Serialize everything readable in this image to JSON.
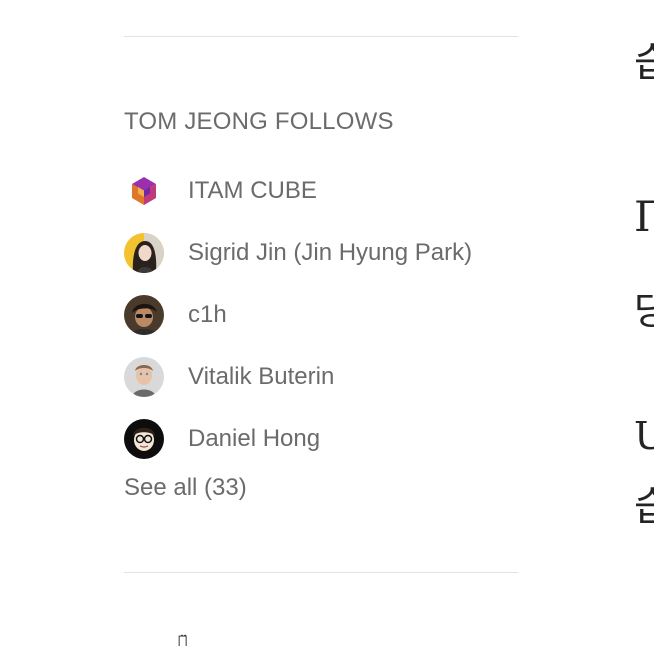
{
  "follows": {
    "title": "TOM JEONG FOLLOWS",
    "items": [
      {
        "name": "ITAM CUBE",
        "avatar_icon": "itam-cube-logo-icon"
      },
      {
        "name": "Sigrid Jin (Jin Hyung Park)",
        "avatar_icon": "person-avatar-icon"
      },
      {
        "name": "c1h",
        "avatar_icon": "person-avatar-icon"
      },
      {
        "name": "Vitalik Buterin",
        "avatar_icon": "person-avatar-icon"
      },
      {
        "name": "Daniel Hong",
        "avatar_icon": "person-avatar-icon"
      }
    ],
    "see_all_label": "See all (33)"
  },
  "right_column": {
    "fragments": [
      "습",
      "П",
      "당",
      "U",
      "습"
    ]
  },
  "bottom": {
    "fragment": "ᅟ̈"
  },
  "colors": {
    "text_secondary": "#6b6b6b",
    "divider": "#e2e2e2",
    "text_primary": "#242424"
  }
}
